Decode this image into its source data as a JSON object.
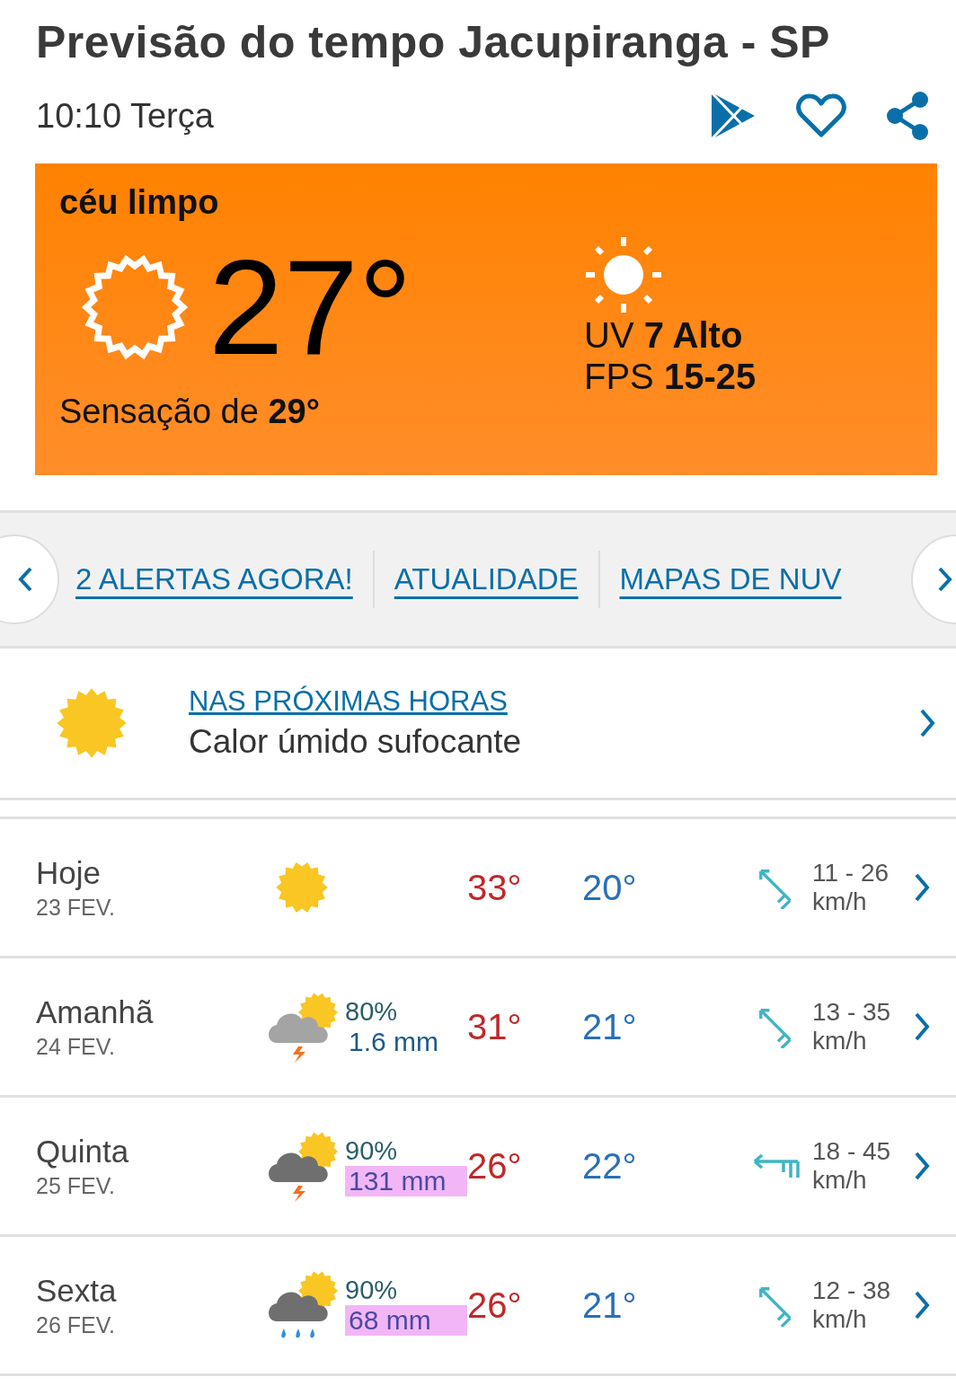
{
  "header": {
    "title": "Previsão do tempo Jacupiranga - SP",
    "time": "10:10 Terça"
  },
  "current": {
    "condition": "céu limpo",
    "temperature": "27°",
    "feels_like": "Sensação de **29°**",
    "uv": "UV **7 Alto**",
    "fps": "FPS **15-25**"
  },
  "nav_tabs": [
    {
      "label": "2 ALERTAS AGORA!"
    },
    {
      "label": "ATUALIDADE"
    },
    {
      "label": "MAPAS DE NUV"
    }
  ],
  "next_hours": {
    "link": "NAS PRÓXIMAS HORAS",
    "summary": "Calor úmido sufocante"
  },
  "days": [
    {
      "day": "Hoje",
      "date": "23 FEV.",
      "kind": "sun",
      "max": "33°",
      "min": "20°",
      "wind": {
        "kind": "diagonal",
        "speed": "11 - 26",
        "unit": "km/h"
      }
    },
    {
      "day": "Amanhã",
      "date": "24 FEV.",
      "kind": "storm_light",
      "chance": "80%",
      "rain": "1.6 mm",
      "highlighted": false,
      "max": "31°",
      "min": "21°",
      "wind": {
        "kind": "diagonal",
        "speed": "13 - 35",
        "unit": "km/h"
      }
    },
    {
      "day": "Quinta",
      "date": "25 FEV.",
      "kind": "storm",
      "chance": "90%",
      "rain": "131 mm",
      "highlighted": true,
      "max": "26°",
      "min": "22°",
      "wind": {
        "kind": "horizontal",
        "speed": "18 - 45",
        "unit": "km/h"
      }
    },
    {
      "day": "Sexta",
      "date": "26 FEV.",
      "kind": "rain",
      "chance": "90%",
      "rain": "68 mm",
      "highlighted": true,
      "max": "26°",
      "min": "21°",
      "wind": {
        "kind": "diagonal",
        "speed": "12 - 38",
        "unit": "km/h"
      }
    }
  ]
}
